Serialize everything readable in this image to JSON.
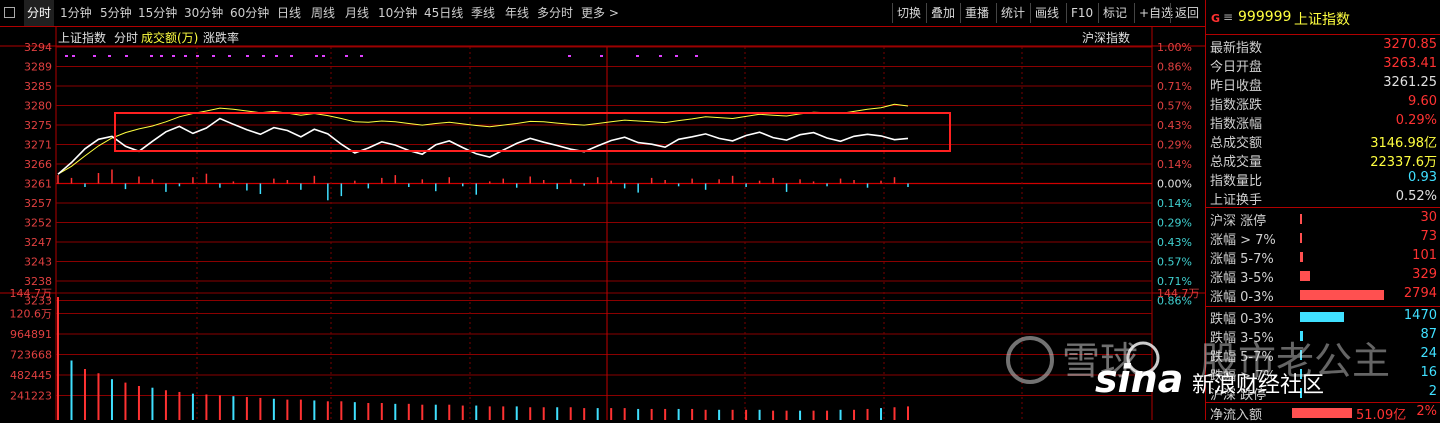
{
  "toolbar": {
    "periods": [
      "分时",
      "1分钟",
      "5分钟",
      "15分钟",
      "30分钟",
      "60分钟",
      "日线",
      "周线",
      "月线",
      "10分钟",
      "45日线",
      "季线",
      "年线",
      "多分时",
      "更多 >"
    ],
    "right_buttons": [
      "切换",
      "叠加",
      "重播",
      "统计",
      "画线",
      "F10",
      "标记",
      "+自选",
      "返回"
    ]
  },
  "chart_header": {
    "name": "上证指数",
    "mode": "分时",
    "volume_label": "成交额(万)",
    "change_label": "涨跌率",
    "right_tag": "沪深指数"
  },
  "price_axis_left": [
    "3294",
    "3289",
    "3285",
    "3280",
    "3275",
    "3271",
    "3266",
    "3261",
    "3257",
    "3252",
    "3247",
    "3243",
    "3238",
    "3233"
  ],
  "pct_axis_right": [
    "1.00%",
    "0.86%",
    "0.71%",
    "0.57%",
    "0.43%",
    "0.29%",
    "0.14%",
    "0.00%",
    "0.14%",
    "0.29%",
    "0.43%",
    "0.57%",
    "0.71%",
    "0.86%"
  ],
  "volume_axis_left": [
    "144.7万",
    "120.6万",
    "964891",
    "723668",
    "482445",
    "241223"
  ],
  "volume_axis_right": [
    "144.7万"
  ],
  "colors": {
    "up": "#ff3232",
    "down": "#40e0ff",
    "price_line": "#ffffff",
    "avg_line": "#ffff40",
    "grid": "#b00000",
    "highlight_box": "#ff2020"
  },
  "chart_data": {
    "type": "line",
    "prev_close": 3261.25,
    "ylim": [
      3233,
      3294
    ],
    "series": [
      {
        "values": [
          3263.4,
          3266.2,
          3269.5,
          3271.8,
          3272.5,
          3270.1,
          3268.9,
          3271.3,
          3273.6,
          3274.9,
          3273.2,
          3274.5,
          3276.8,
          3275.4,
          3274.1,
          3273.0,
          3274.6,
          3273.9,
          3272.4,
          3274.2,
          3273.1,
          3270.6,
          3268.5,
          3269.7,
          3271.2,
          3270.4,
          3269.1,
          3268.2,
          3270.5,
          3271.4,
          3269.8,
          3268.3,
          3267.5,
          3269.2,
          3270.8,
          3272.0,
          3271.1,
          3270.3,
          3269.4,
          3268.8,
          3270.2,
          3271.5,
          3272.3,
          3271.0,
          3270.6,
          3269.9,
          3271.8,
          3272.4,
          3273.1,
          3272.0,
          3271.4,
          3272.7,
          3273.5,
          3272.2,
          3271.6,
          3272.9,
          3273.4,
          3272.1,
          3271.3,
          3272.5,
          3273.0,
          3272.6,
          3271.7,
          3272.0
        ]
      },
      {
        "values": [
          3263.4,
          3265.3,
          3267.8,
          3270.2,
          3272.1,
          3273.4,
          3274.3,
          3275.0,
          3276.0,
          3277.2,
          3278.0,
          3278.6,
          3279.3,
          3279.0,
          3278.6,
          3278.2,
          3278.5,
          3278.1,
          3277.6,
          3278.0,
          3277.5,
          3276.8,
          3276.0,
          3275.9,
          3276.2,
          3276.0,
          3275.6,
          3275.2,
          3275.6,
          3275.9,
          3275.5,
          3275.1,
          3274.8,
          3275.2,
          3275.6,
          3276.1,
          3276.0,
          3275.7,
          3275.4,
          3275.2,
          3275.6,
          3276.0,
          3276.4,
          3276.2,
          3276.0,
          3275.8,
          3276.3,
          3276.7,
          3277.2,
          3277.0,
          3276.8,
          3277.3,
          3277.8,
          3277.6,
          3277.4,
          3277.9,
          3278.3,
          3278.2,
          3278.0,
          3278.5,
          3279.0,
          3279.4,
          3280.2,
          3279.8
        ]
      }
    ],
    "advance_decline_bars": [
      1.2,
      0.8,
      -0.5,
      1.5,
      2.0,
      -0.8,
      1.0,
      0.6,
      -1.2,
      -0.4,
      0.9,
      1.4,
      -0.6,
      0.3,
      -1.0,
      -1.5,
      0.7,
      0.5,
      -0.9,
      1.1,
      -2.4,
      -1.8,
      0.4,
      -0.7,
      0.8,
      1.2,
      -0.5,
      0.6,
      -1.1,
      0.9,
      -0.4,
      -1.6,
      0.3,
      0.7,
      -0.6,
      1.0,
      0.5,
      -0.8,
      0.6,
      -0.3,
      0.9,
      0.4,
      -0.7,
      -1.3,
      0.8,
      0.5,
      -0.4,
      0.7,
      -0.9,
      0.6,
      1.1,
      -0.5,
      0.4,
      0.8,
      -1.2,
      0.6,
      0.3,
      -0.4,
      0.7,
      0.5,
      -0.6,
      0.4,
      0.9,
      -0.5
    ],
    "volume": [
      144.7,
      70,
      60,
      55,
      48,
      44,
      40,
      38,
      35,
      33,
      31,
      30,
      29,
      28,
      27,
      26,
      25,
      24,
      24,
      23,
      22,
      22,
      21,
      20,
      20,
      19,
      19,
      18,
      18,
      18,
      17,
      17,
      16,
      16,
      16,
      15,
      15,
      15,
      15,
      14,
      14,
      14,
      14,
      13,
      13,
      13,
      13,
      13,
      12,
      12,
      12,
      12,
      12,
      11,
      11,
      11,
      11,
      11,
      12,
      12,
      13,
      14,
      15,
      16
    ]
  },
  "quote": {
    "prefix": "G",
    "menu_glyph": "≡",
    "code": "999999",
    "name": "上证指数",
    "rows": [
      {
        "label": "最新指数",
        "value": "3270.85",
        "color": "red"
      },
      {
        "label": "今日开盘",
        "value": "3263.41",
        "color": "red"
      },
      {
        "label": "昨日收盘",
        "value": "3261.25",
        "color": "white"
      },
      {
        "label": "指数涨跌",
        "value": "9.60",
        "color": "red"
      },
      {
        "label": "指数涨幅",
        "value": "0.29%",
        "color": "red"
      },
      {
        "label": "总成交额",
        "value": "3146.98亿",
        "color": "yellow"
      },
      {
        "label": "总成交量",
        "value": "22337.6万",
        "color": "yellow"
      },
      {
        "label": "指数量比",
        "value": "0.93",
        "color": "cyan"
      },
      {
        "label": "上证换手",
        "value": "0.52%",
        "color": "white"
      }
    ],
    "breadth_up": [
      {
        "label": "沪深 涨停",
        "value": "30",
        "pct": 0.011
      },
      {
        "label": "涨幅 > 7%",
        "value": "73",
        "pct": 0.026
      },
      {
        "label": "涨幅 5-7%",
        "value": "101",
        "pct": 0.036
      },
      {
        "label": "涨幅 3-5%",
        "value": "329",
        "pct": 0.118
      },
      {
        "label": "涨幅 0-3%",
        "value": "2794",
        "pct": 1.0
      }
    ],
    "breadth_down": [
      {
        "label": "跌幅 0-3%",
        "value": "1470",
        "pct": 0.526
      },
      {
        "label": "跌幅 3-5%",
        "value": "87",
        "pct": 0.031
      },
      {
        "label": "跌幅 5-7%",
        "value": "24",
        "pct": 0.009
      },
      {
        "label": "跌幅 > 7%",
        "value": "16",
        "pct": 0.006
      },
      {
        "label": "沪深 跌停",
        "value": "2",
        "pct": 0.001
      }
    ],
    "net_inflow": {
      "label": "净流入额",
      "value": "51.09亿",
      "pct_text": "2%"
    }
  },
  "watermark": {
    "site": "雪球",
    "brand": "sina",
    "brand_cn": "新浪财经社区",
    "author": "股市老公主"
  }
}
